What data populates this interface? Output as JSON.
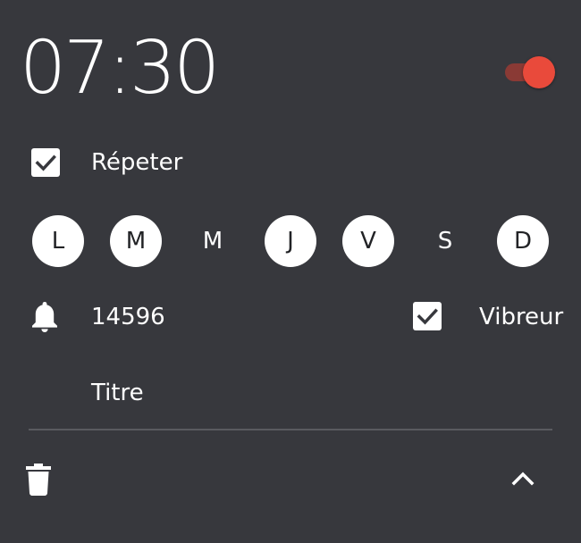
{
  "alarm": {
    "time": "07:30",
    "enabled": true
  },
  "repeat": {
    "label": "Répeter",
    "checked": true
  },
  "days": [
    {
      "letter": "L",
      "selected": true
    },
    {
      "letter": "M",
      "selected": true
    },
    {
      "letter": "M",
      "selected": false
    },
    {
      "letter": "J",
      "selected": true
    },
    {
      "letter": "V",
      "selected": true
    },
    {
      "letter": "S",
      "selected": false
    },
    {
      "letter": "D",
      "selected": true
    }
  ],
  "ringtone": {
    "icon": "bell-icon",
    "value": "14596"
  },
  "vibrate": {
    "label": "Vibreur",
    "checked": true
  },
  "title": {
    "label": "Titre"
  },
  "actions": {
    "delete_icon": "trash-icon",
    "collapse_icon": "chevron-up-icon"
  },
  "colors": {
    "background": "#37383d",
    "accent": "#e94a3b",
    "toggle_track": "#8a3a35"
  }
}
